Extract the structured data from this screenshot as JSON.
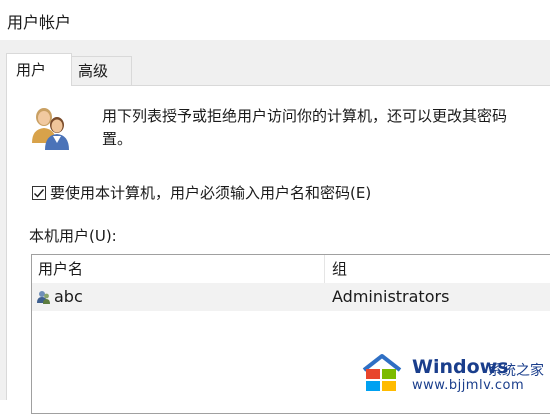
{
  "window": {
    "title": "用户帐户"
  },
  "tabs": [
    {
      "label": "用户",
      "active": true
    },
    {
      "label": "高级",
      "active": false
    }
  ],
  "panel": {
    "description_line1": "用下列表授予或拒绝用户访问你的计算机，还可以更改其密码",
    "description_line2": "置。",
    "require_password": {
      "label": "要使用本计算机，用户必须输入用户名和密码(E)",
      "checked": true
    },
    "users_label": "本机用户(U):",
    "table": {
      "columns": [
        "用户名",
        "组"
      ],
      "rows": [
        {
          "name": "abc",
          "group": "Administrators",
          "selected": true
        }
      ]
    }
  },
  "watermark": {
    "brand": "Windows",
    "cn_text": "系统之家",
    "url": "www.bjjmlv.com"
  },
  "colors": {
    "tab_strip_bg": "#f0f0f0",
    "selected_row_bg": "#f2f2f2",
    "watermark_blue": "#1a3e8c"
  }
}
